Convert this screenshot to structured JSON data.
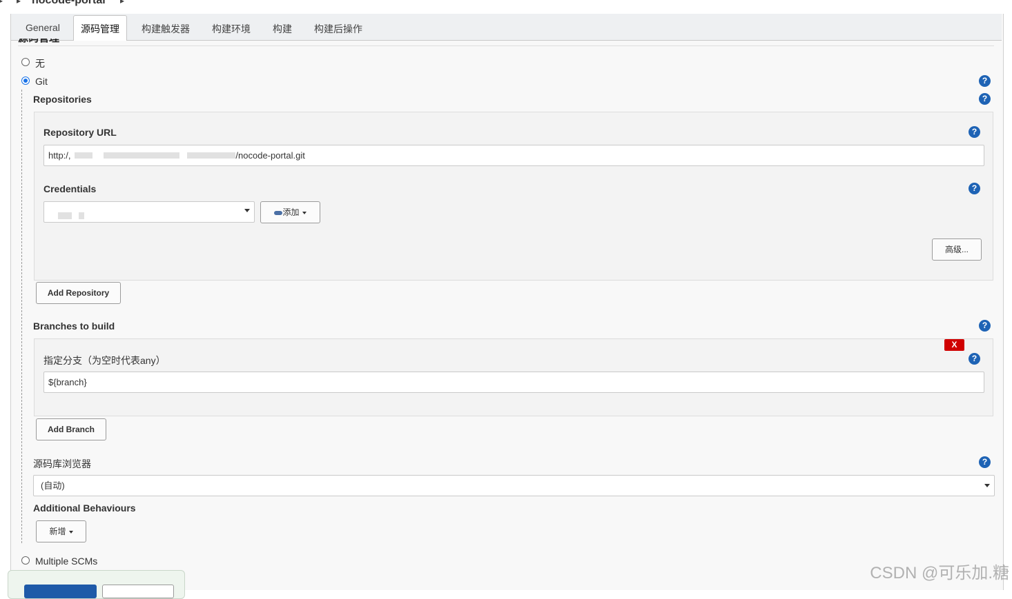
{
  "breadcrumb": {
    "job_name": "nocode-portal"
  },
  "tabs": [
    {
      "label": "General"
    },
    {
      "label": "源码管理"
    },
    {
      "label": "构建触发器"
    },
    {
      "label": "构建环境"
    },
    {
      "label": "构建"
    },
    {
      "label": "构建后操作"
    }
  ],
  "scm": {
    "option_none": "无",
    "option_git": "Git",
    "option_multiple": "Multiple SCMs",
    "selected": "Git"
  },
  "repositories": {
    "heading": "Repositories",
    "url_label": "Repository URL",
    "url_prefix": "http:/,",
    "url_suffix": "/nocode-portal.git",
    "credentials_label": "Credentials",
    "add_label": "添加",
    "advanced_label": "高级...",
    "add_repository_label": "Add Repository"
  },
  "branches": {
    "heading": "Branches to build",
    "specifier_label": "指定分支（为空时代表any）",
    "specifier_value": "${branch}",
    "delete_label": "X",
    "add_branch_label": "Add Branch"
  },
  "browser": {
    "label": "源码库浏览器",
    "value": "(自动)"
  },
  "behaviours": {
    "heading": "Additional Behaviours",
    "add_label": "新增"
  },
  "help_symbol": "?",
  "watermark": "CSDN @可乐加.糖",
  "colors": {
    "help": "#1e63b5",
    "radio_selected": "#1a73e8",
    "delete": "#d00000"
  }
}
